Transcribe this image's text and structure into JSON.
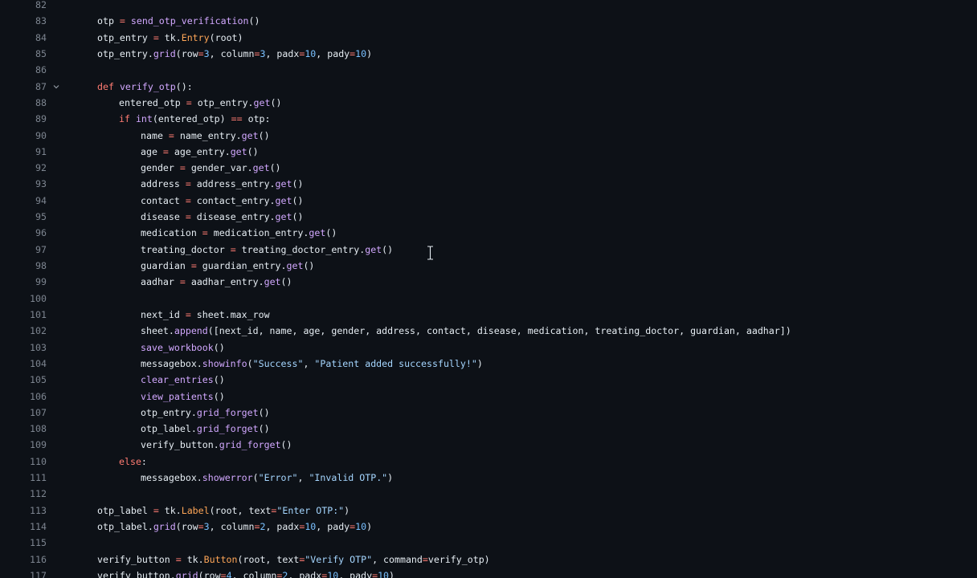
{
  "editor": {
    "lines": [
      {
        "n": "82",
        "indent": 0,
        "tokens": []
      },
      {
        "n": "83",
        "indent": 0,
        "tokens": [
          [
            "plain",
            "otp "
          ],
          [
            "op",
            "="
          ],
          [
            "plain",
            " "
          ],
          [
            "fn",
            "send_otp_verification"
          ],
          [
            "plain",
            "()"
          ]
        ]
      },
      {
        "n": "84",
        "indent": 0,
        "tokens": [
          [
            "plain",
            "otp_entry "
          ],
          [
            "op",
            "="
          ],
          [
            "plain",
            " tk."
          ],
          [
            "cls",
            "Entry"
          ],
          [
            "plain",
            "(root)"
          ]
        ]
      },
      {
        "n": "85",
        "indent": 0,
        "tokens": [
          [
            "plain",
            "otp_entry."
          ],
          [
            "fn",
            "grid"
          ],
          [
            "plain",
            "(row"
          ],
          [
            "op",
            "="
          ],
          [
            "num",
            "3"
          ],
          [
            "plain",
            ", column"
          ],
          [
            "op",
            "="
          ],
          [
            "num",
            "3"
          ],
          [
            "plain",
            ", padx"
          ],
          [
            "op",
            "="
          ],
          [
            "num",
            "10"
          ],
          [
            "plain",
            ", pady"
          ],
          [
            "op",
            "="
          ],
          [
            "num",
            "10"
          ],
          [
            "plain",
            ")"
          ]
        ]
      },
      {
        "n": "86",
        "indent": 0,
        "tokens": []
      },
      {
        "n": "87",
        "indent": 0,
        "fold": true,
        "tokens": [
          [
            "kw",
            "def"
          ],
          [
            "plain",
            " "
          ],
          [
            "fn",
            "verify_otp"
          ],
          [
            "plain",
            "():"
          ]
        ]
      },
      {
        "n": "88",
        "indent": 1,
        "tokens": [
          [
            "plain",
            "entered_otp "
          ],
          [
            "op",
            "="
          ],
          [
            "plain",
            " otp_entry."
          ],
          [
            "fn",
            "get"
          ],
          [
            "plain",
            "()"
          ]
        ]
      },
      {
        "n": "89",
        "indent": 1,
        "tokens": [
          [
            "kw",
            "if"
          ],
          [
            "plain",
            " "
          ],
          [
            "fn",
            "int"
          ],
          [
            "plain",
            "(entered_otp) "
          ],
          [
            "op",
            "=="
          ],
          [
            "plain",
            " otp:"
          ]
        ]
      },
      {
        "n": "90",
        "indent": 2,
        "tokens": [
          [
            "plain",
            "name "
          ],
          [
            "op",
            "="
          ],
          [
            "plain",
            " name_entry."
          ],
          [
            "fn",
            "get"
          ],
          [
            "plain",
            "()"
          ]
        ]
      },
      {
        "n": "91",
        "indent": 2,
        "tokens": [
          [
            "plain",
            "age "
          ],
          [
            "op",
            "="
          ],
          [
            "plain",
            " age_entry."
          ],
          [
            "fn",
            "get"
          ],
          [
            "plain",
            "()"
          ]
        ]
      },
      {
        "n": "92",
        "indent": 2,
        "tokens": [
          [
            "plain",
            "gender "
          ],
          [
            "op",
            "="
          ],
          [
            "plain",
            " gender_var."
          ],
          [
            "fn",
            "get"
          ],
          [
            "plain",
            "()"
          ]
        ]
      },
      {
        "n": "93",
        "indent": 2,
        "tokens": [
          [
            "plain",
            "address "
          ],
          [
            "op",
            "="
          ],
          [
            "plain",
            " address_entry."
          ],
          [
            "fn",
            "get"
          ],
          [
            "plain",
            "()"
          ]
        ]
      },
      {
        "n": "94",
        "indent": 2,
        "tokens": [
          [
            "plain",
            "contact "
          ],
          [
            "op",
            "="
          ],
          [
            "plain",
            " contact_entry."
          ],
          [
            "fn",
            "get"
          ],
          [
            "plain",
            "()"
          ]
        ]
      },
      {
        "n": "95",
        "indent": 2,
        "tokens": [
          [
            "plain",
            "disease "
          ],
          [
            "op",
            "="
          ],
          [
            "plain",
            " disease_entry."
          ],
          [
            "fn",
            "get"
          ],
          [
            "plain",
            "()"
          ]
        ]
      },
      {
        "n": "96",
        "indent": 2,
        "tokens": [
          [
            "plain",
            "medication "
          ],
          [
            "op",
            "="
          ],
          [
            "plain",
            " medication_entry."
          ],
          [
            "fn",
            "get"
          ],
          [
            "plain",
            "()"
          ]
        ]
      },
      {
        "n": "97",
        "indent": 2,
        "tokens": [
          [
            "plain",
            "treating_doctor "
          ],
          [
            "op",
            "="
          ],
          [
            "plain",
            " treating_doctor_entry."
          ],
          [
            "fn",
            "get"
          ],
          [
            "plain",
            "()"
          ]
        ]
      },
      {
        "n": "98",
        "indent": 2,
        "tokens": [
          [
            "plain",
            "guardian "
          ],
          [
            "op",
            "="
          ],
          [
            "plain",
            " guardian_entry."
          ],
          [
            "fn",
            "get"
          ],
          [
            "plain",
            "()"
          ]
        ]
      },
      {
        "n": "99",
        "indent": 2,
        "tokens": [
          [
            "plain",
            "aadhar "
          ],
          [
            "op",
            "="
          ],
          [
            "plain",
            " aadhar_entry."
          ],
          [
            "fn",
            "get"
          ],
          [
            "plain",
            "()"
          ]
        ]
      },
      {
        "n": "100",
        "indent": 0,
        "tokens": []
      },
      {
        "n": "101",
        "indent": 2,
        "tokens": [
          [
            "plain",
            "next_id "
          ],
          [
            "op",
            "="
          ],
          [
            "plain",
            " sheet.max_row"
          ]
        ]
      },
      {
        "n": "102",
        "indent": 2,
        "tokens": [
          [
            "plain",
            "sheet."
          ],
          [
            "fn",
            "append"
          ],
          [
            "plain",
            "([next_id, name, age, gender, address, contact, disease, medication, treating_doctor, guardian, aadhar])"
          ]
        ]
      },
      {
        "n": "103",
        "indent": 2,
        "tokens": [
          [
            "fn",
            "save_workbook"
          ],
          [
            "plain",
            "()"
          ]
        ]
      },
      {
        "n": "104",
        "indent": 2,
        "tokens": [
          [
            "plain",
            "messagebox."
          ],
          [
            "fn",
            "showinfo"
          ],
          [
            "plain",
            "("
          ],
          [
            "str",
            "\"Success\""
          ],
          [
            "plain",
            ", "
          ],
          [
            "str",
            "\"Patient added successfully!\""
          ],
          [
            "plain",
            ")"
          ]
        ]
      },
      {
        "n": "105",
        "indent": 2,
        "tokens": [
          [
            "fn",
            "clear_entries"
          ],
          [
            "plain",
            "()"
          ]
        ]
      },
      {
        "n": "106",
        "indent": 2,
        "tokens": [
          [
            "fn",
            "view_patients"
          ],
          [
            "plain",
            "()"
          ]
        ]
      },
      {
        "n": "107",
        "indent": 2,
        "tokens": [
          [
            "plain",
            "otp_entry."
          ],
          [
            "fn",
            "grid_forget"
          ],
          [
            "plain",
            "()"
          ]
        ]
      },
      {
        "n": "108",
        "indent": 2,
        "tokens": [
          [
            "plain",
            "otp_label."
          ],
          [
            "fn",
            "grid_forget"
          ],
          [
            "plain",
            "()"
          ]
        ]
      },
      {
        "n": "109",
        "indent": 2,
        "tokens": [
          [
            "plain",
            "verify_button."
          ],
          [
            "fn",
            "grid_forget"
          ],
          [
            "plain",
            "()"
          ]
        ]
      },
      {
        "n": "110",
        "indent": 1,
        "tokens": [
          [
            "kw",
            "else"
          ],
          [
            "plain",
            ":"
          ]
        ]
      },
      {
        "n": "111",
        "indent": 2,
        "tokens": [
          [
            "plain",
            "messagebox."
          ],
          [
            "fn",
            "showerror"
          ],
          [
            "plain",
            "("
          ],
          [
            "str",
            "\"Error\""
          ],
          [
            "plain",
            ", "
          ],
          [
            "str",
            "\"Invalid OTP.\""
          ],
          [
            "plain",
            ")"
          ]
        ]
      },
      {
        "n": "112",
        "indent": 0,
        "tokens": []
      },
      {
        "n": "113",
        "indent": 0,
        "tokens": [
          [
            "plain",
            "otp_label "
          ],
          [
            "op",
            "="
          ],
          [
            "plain",
            " tk."
          ],
          [
            "cls",
            "Label"
          ],
          [
            "plain",
            "(root, text"
          ],
          [
            "op",
            "="
          ],
          [
            "str",
            "\"Enter OTP:\""
          ],
          [
            "plain",
            ")"
          ]
        ]
      },
      {
        "n": "114",
        "indent": 0,
        "tokens": [
          [
            "plain",
            "otp_label."
          ],
          [
            "fn",
            "grid"
          ],
          [
            "plain",
            "(row"
          ],
          [
            "op",
            "="
          ],
          [
            "num",
            "3"
          ],
          [
            "plain",
            ", column"
          ],
          [
            "op",
            "="
          ],
          [
            "num",
            "2"
          ],
          [
            "plain",
            ", padx"
          ],
          [
            "op",
            "="
          ],
          [
            "num",
            "10"
          ],
          [
            "plain",
            ", pady"
          ],
          [
            "op",
            "="
          ],
          [
            "num",
            "10"
          ],
          [
            "plain",
            ")"
          ]
        ]
      },
      {
        "n": "115",
        "indent": 0,
        "tokens": []
      },
      {
        "n": "116",
        "indent": 0,
        "tokens": [
          [
            "plain",
            "verify_button "
          ],
          [
            "op",
            "="
          ],
          [
            "plain",
            " tk."
          ],
          [
            "cls",
            "Button"
          ],
          [
            "plain",
            "(root, text"
          ],
          [
            "op",
            "="
          ],
          [
            "str",
            "\"Verify OTP\""
          ],
          [
            "plain",
            ", command"
          ],
          [
            "op",
            "="
          ],
          [
            "plain",
            "verify_otp)"
          ]
        ]
      },
      {
        "n": "117",
        "indent": 0,
        "tokens": [
          [
            "plain",
            "verify_button."
          ],
          [
            "fn",
            "grid"
          ],
          [
            "plain",
            "(row"
          ],
          [
            "op",
            "="
          ],
          [
            "num",
            "4"
          ],
          [
            "plain",
            ", column"
          ],
          [
            "op",
            "="
          ],
          [
            "num",
            "2"
          ],
          [
            "plain",
            ", padx"
          ],
          [
            "op",
            "="
          ],
          [
            "num",
            "10"
          ],
          [
            "plain",
            ", pady"
          ],
          [
            "op",
            "="
          ],
          [
            "num",
            "10"
          ],
          [
            "plain",
            ")"
          ]
        ]
      }
    ]
  },
  "icons": {
    "fold": "chevron-down-icon",
    "cursor": "text-cursor-icon"
  },
  "colors": {
    "background": "#0d1117",
    "line_number": "#7d8590",
    "plain": "#e6edf3",
    "function": "#d2a8ff",
    "keyword": "#ff7b72",
    "number": "#79c0ff",
    "string": "#a5d6ff",
    "class": "#ffa657"
  }
}
